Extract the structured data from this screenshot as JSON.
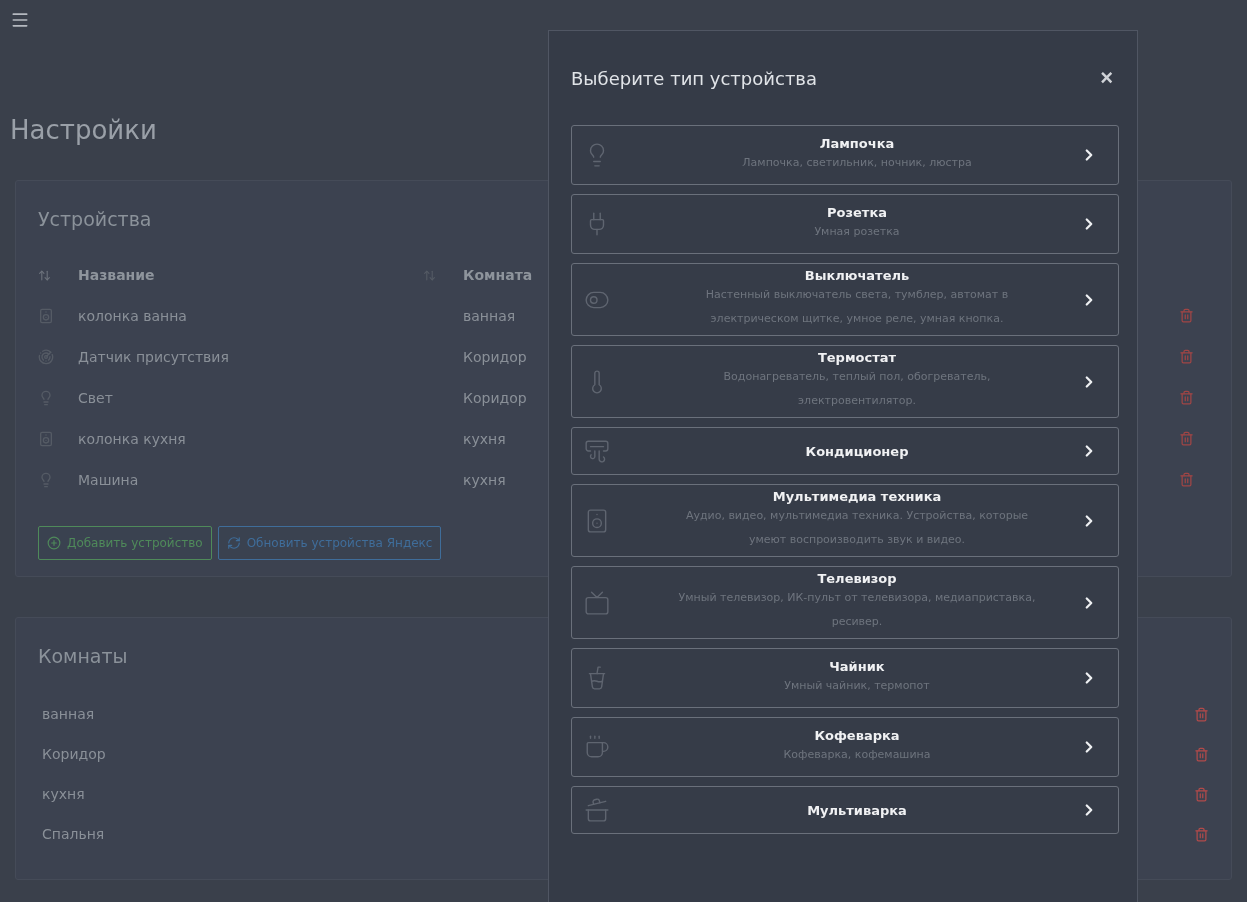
{
  "page_title": "Настройки",
  "devices": {
    "title": "Устройства",
    "columns": [
      "Название",
      "Комната"
    ],
    "rows": [
      {
        "name": "колонка ванна",
        "room": "ванная"
      },
      {
        "name": "Датчик присутствия",
        "room": "Коридор"
      },
      {
        "name": "Свет",
        "room": "Коридор"
      },
      {
        "name": "колонка кухня",
        "room": "кухня"
      },
      {
        "name": "Машина",
        "room": "кухня"
      }
    ],
    "buttons": [
      {
        "label": "Добавить устройство",
        "kind": "add"
      },
      {
        "label": "Обновить устройства Яндекс",
        "kind": "refresh"
      }
    ]
  },
  "rooms": {
    "title": "Комнаты",
    "items": [
      "ванная",
      "Коридор",
      "кухня",
      "Спальня"
    ]
  },
  "modal": {
    "title": "Выберите тип устройства",
    "close": "×",
    "types": [
      {
        "name": "Лампочка",
        "description": "Лампочка, светильник, ночник, люстра"
      },
      {
        "name": "Розетка",
        "description": "Умная розетка"
      },
      {
        "name": "Выключатель",
        "description": "Настенный выключатель света, тумблер, автомат в электрическом щитке, умное реле, умная кнопка."
      },
      {
        "name": "Термостат",
        "description": "Водонагреватель, теплый пол, обогреватель, электровентилятор."
      },
      {
        "name": "Кондиционер"
      },
      {
        "name": "Мультимедиа техника",
        "description": "Аудио, видео, мультимедиа техника. Устройства, которые умеют воспроизводить звук и видео."
      },
      {
        "name": "Телевизор",
        "description": "Умный телевизор, ИК-пульт от телевизора, медиаприставка, ресивер."
      },
      {
        "name": "Чайник",
        "description": "Умный чайник, термопот"
      },
      {
        "name": "Кофеварка",
        "description": "Кофеварка, кофемашина"
      },
      {
        "name": "Мультиварка"
      }
    ]
  }
}
